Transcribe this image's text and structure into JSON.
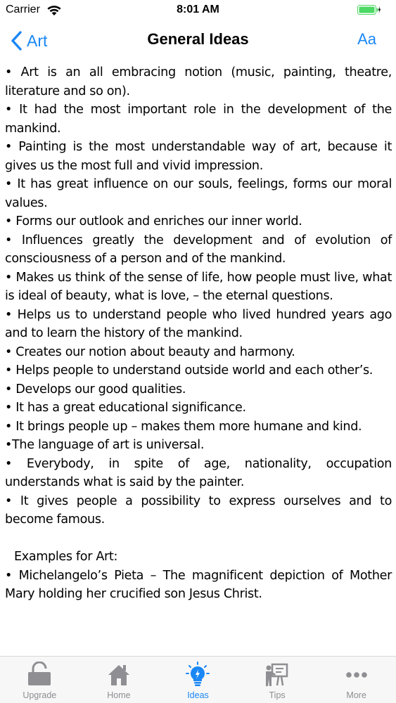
{
  "status_bar": {
    "carrier": "Carrier",
    "time": "8:01 AM"
  },
  "nav": {
    "back_label": "Art",
    "title": "General Ideas",
    "font_button": "Aa"
  },
  "content": {
    "paragraphs": [
      "• Art is an all embracing notion (music, painting, theatre, literature and so on).",
      "• It had the most important role in the development of the mankind.",
      "• Painting is the most understandable way of art, because it gives us the most full and vivid impression.",
      "• It has great influence on our souls, feelings, forms our moral values.",
      "• Forms our outlook and enriches our inner world.",
      "• Influences greatly the development and of evolution of consciousness of a person and of the mankind.",
      "• Makes us think of the sense of life, how people must live, what is ideal of beauty, what is love, – the eternal questions.",
      "• Helps us to understand people who lived hundred years ago and to learn the history of the mankind.",
      "• Creates our notion about beauty and harmony.",
      "•  Helps people to understand outside world and each other’s.",
      "• Develops our good qualities.",
      "• It has a great educational significance.",
      "• It brings people up – makes them more humane and kind.",
      "•The language of art is universal.",
      "• Everybody, in spite of age, nationality, occupation understands what is said by the painter.",
      "• It gives people a possibility to express ourselves and to become famous."
    ],
    "examples_heading": "Examples for Art:",
    "example_1": "• Michelangelo’s Pieta – The magnificent depiction of Mother Mary holding her crucified son Jesus Christ."
  },
  "tabs": [
    {
      "label": "Upgrade",
      "icon": "lock-icon",
      "active": false
    },
    {
      "label": "Home",
      "icon": "home-icon",
      "active": false
    },
    {
      "label": "Ideas",
      "icon": "lightbulb-icon",
      "active": true
    },
    {
      "label": "Tips",
      "icon": "teacher-board-icon",
      "active": false
    },
    {
      "label": "More",
      "icon": "more-dots-icon",
      "active": false
    }
  ],
  "colors": {
    "accent": "#1a87f5",
    "inactive_tab": "#8e8e93",
    "tab_bar_bg": "#f7f7f7",
    "battery": "#4cd964"
  }
}
